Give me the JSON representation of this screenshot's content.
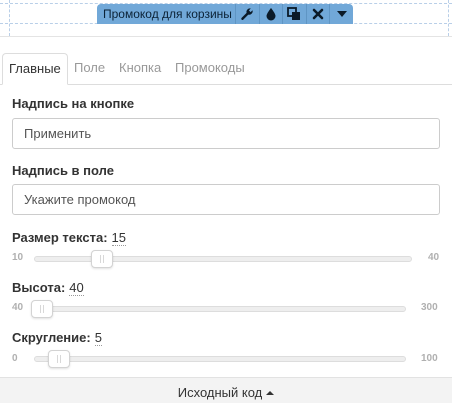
{
  "widget_toolbar": {
    "title": "Промокод для корзины",
    "icons": [
      "wrench-icon",
      "drop-icon",
      "duplicate-icon",
      "close-icon",
      "dropdown-icon"
    ]
  },
  "tabs": [
    {
      "label": "Главные",
      "active": true
    },
    {
      "label": "Поле",
      "active": false
    },
    {
      "label": "Кнопка",
      "active": false
    },
    {
      "label": "Промокоды",
      "active": false
    }
  ],
  "fields": {
    "button_text": {
      "label": "Надпись на кнопке",
      "value": "Применить"
    },
    "field_text": {
      "label": "Надпись в поле",
      "value": "Укажите промокод"
    }
  },
  "sliders": {
    "text_size": {
      "label": "Размер текста",
      "sep": ":",
      "value": "15",
      "min": "10",
      "max": "40",
      "level": 0.17
    },
    "height": {
      "label": "Высота",
      "sep": ":",
      "value": "40",
      "min": "40",
      "max": "300",
      "level": 0.0
    },
    "rounding": {
      "label": "Скругление",
      "sep": ":",
      "value": "5",
      "min": "0",
      "max": "100",
      "level": 0.05
    }
  },
  "footer": {
    "label": "Исходный код"
  },
  "colors": {
    "toolbar": "#71a8d8",
    "dashed_guides": "#b9cfe8",
    "footer_bg": "#f3f3f3"
  }
}
